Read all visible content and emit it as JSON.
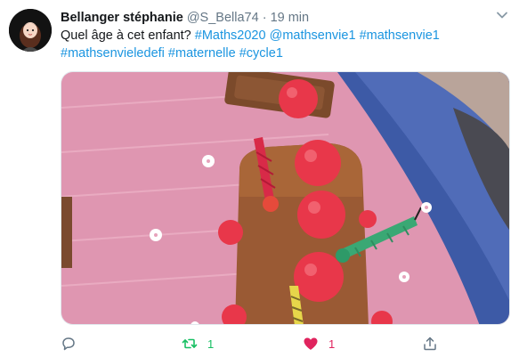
{
  "tweet": {
    "author_name": "Bellanger stéphanie",
    "handle": "@S_Bella74",
    "separator": "·",
    "time": "19 min",
    "text_intro": "Quel âge à cet enfant? ",
    "hashtag_1": "#Maths2020",
    "mention_1": "@mathsenvie1",
    "hashtag_2": "#mathsenvie1",
    "hashtag_3": "#mathsenvieledefi",
    "hashtag_4": "#maternelle",
    "hashtag_5": "#cycle1"
  },
  "media": {
    "icon": "photo-cake-with-candles"
  },
  "actions": {
    "reply_icon": "comment-icon",
    "retweet_count": "1",
    "like_count": "1",
    "share_icon": "share-icon"
  },
  "colors": {
    "link": "#1b95e0",
    "retweet_active": "#17bf63",
    "like_active": "#e0245e",
    "secondary_text": "#657786"
  }
}
